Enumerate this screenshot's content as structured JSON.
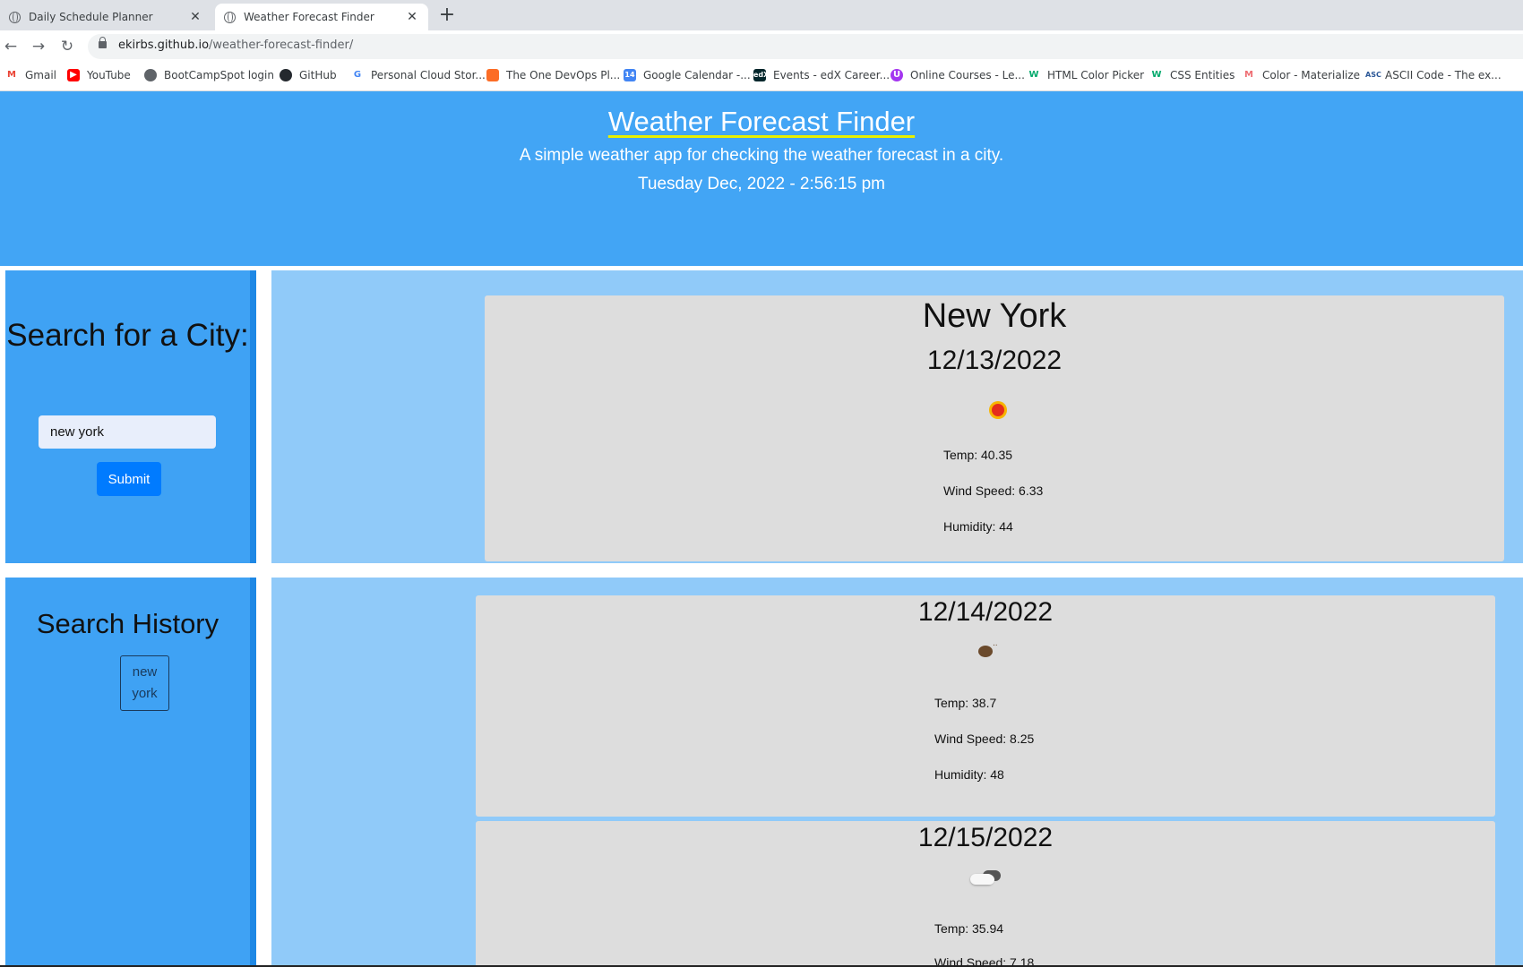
{
  "browser": {
    "tabs": [
      {
        "title": "Daily Schedule Planner",
        "active": false
      },
      {
        "title": "Weather Forecast Finder",
        "active": true
      }
    ],
    "url_host": "ekirbs.github.io",
    "url_path": "/weather-forecast-finder/",
    "bookmarks": [
      {
        "label": "Gmail",
        "icon": "gmail-icon",
        "color": "#ea4335"
      },
      {
        "label": "YouTube",
        "icon": "youtube-icon",
        "color": "#ff0000"
      },
      {
        "label": "BootCampSpot login",
        "icon": "globe-icon",
        "color": "#5f6368"
      },
      {
        "label": "GitHub",
        "icon": "github-icon",
        "color": "#24292e"
      },
      {
        "label": "Personal Cloud Stor...",
        "icon": "google-icon",
        "color": "#4285f4"
      },
      {
        "label": "The One DevOps Pl...",
        "icon": "gitlab-icon",
        "color": "#fc6d26"
      },
      {
        "label": "Google Calendar -...",
        "icon": "calendar-icon",
        "color": "#4285f4"
      },
      {
        "label": "Events - edX Career...",
        "icon": "edx-icon",
        "color": "#02262b"
      },
      {
        "label": "Online Courses - Le...",
        "icon": "udemy-icon",
        "color": "#a435f0"
      },
      {
        "label": "HTML Color Picker",
        "icon": "w3schools-icon",
        "color": "#04aa6d"
      },
      {
        "label": "CSS Entities",
        "icon": "w3schools-icon",
        "color": "#04aa6d"
      },
      {
        "label": "Color - Materialize",
        "icon": "materialize-icon",
        "color": "#ee6e73"
      },
      {
        "label": "ASCII Code - The ex...",
        "icon": "ascii-icon",
        "color": "#2b5797"
      }
    ]
  },
  "header": {
    "title": "Weather Forecast Finder",
    "subtitle": "A simple weather app for checking the weather forecast in a city.",
    "datetime": "Tuesday Dec, 2022 - 2:56:15 pm"
  },
  "search": {
    "heading": "Search for a City:",
    "input_value": "new york",
    "submit_label": "Submit"
  },
  "history": {
    "heading": "Search History",
    "items": [
      "new york"
    ]
  },
  "current": {
    "city": "New York",
    "date": "12/13/2022",
    "icon": "sun-icon",
    "temp": "Temp: 40.35",
    "wind": "Wind Speed: 6.33",
    "humidity": "Humidity: 44"
  },
  "forecast": [
    {
      "date": "12/14/2022",
      "icon": "rain-icon",
      "temp": "Temp: 38.7",
      "wind": "Wind Speed: 8.25",
      "humidity": "Humidity: 48"
    },
    {
      "date": "12/15/2022",
      "icon": "cloud-icon",
      "temp": "Temp: 35.94",
      "wind": "Wind Speed: 7.18",
      "humidity": ""
    }
  ],
  "colors": {
    "header_bg": "#42a5f5",
    "sidebar_bg": "#3fa2f4",
    "main_bg": "#90caf9",
    "card_bg": "#dddddd",
    "submit_bg": "#007bff"
  }
}
